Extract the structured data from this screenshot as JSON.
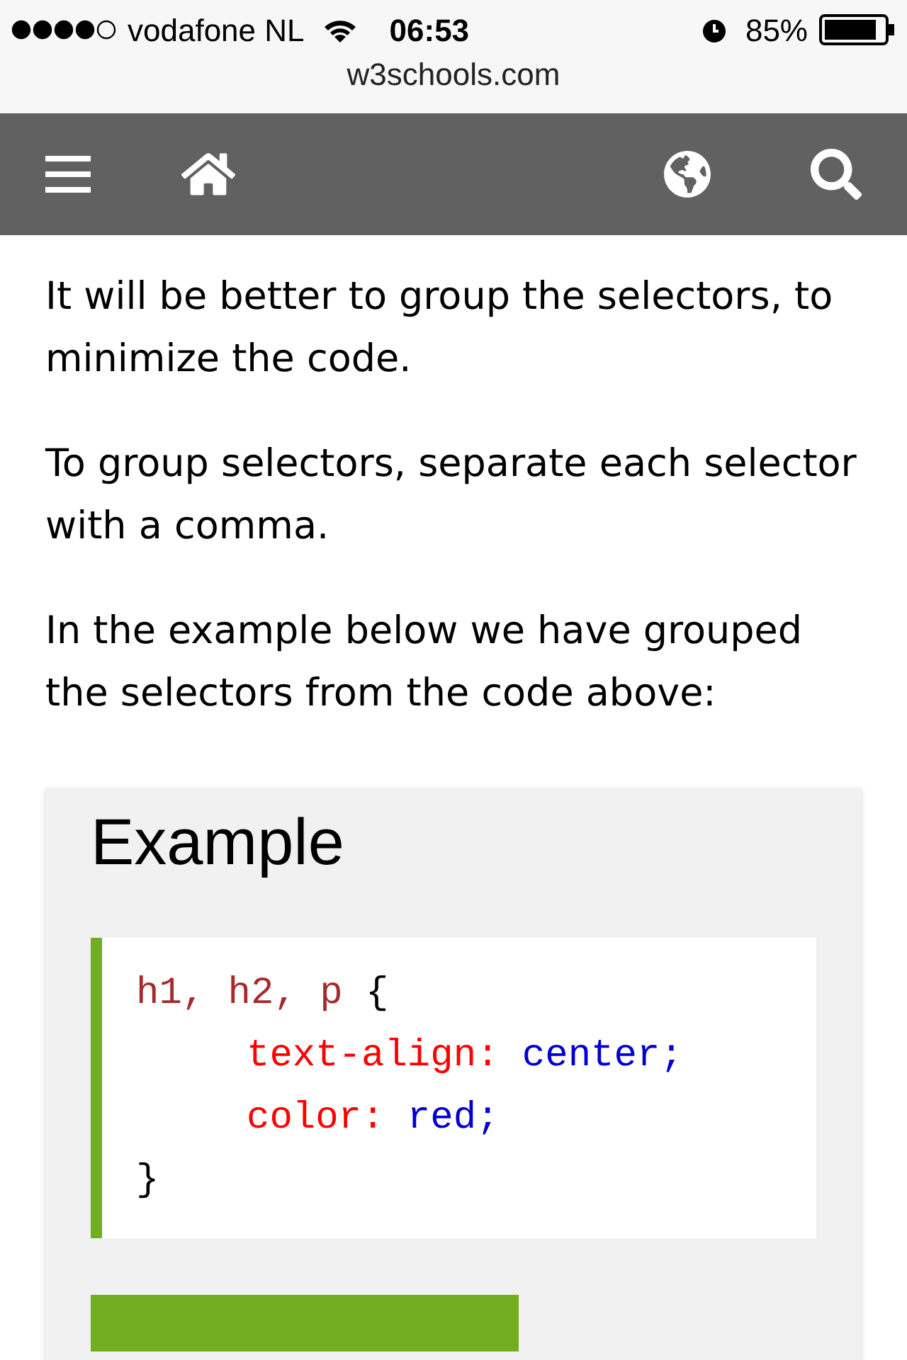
{
  "status_bar": {
    "carrier": "vodafone NL",
    "time": "06:53",
    "battery": "85%"
  },
  "address_bar": {
    "url": "w3schools.com"
  },
  "paragraphs": [
    "It will be better to group the selectors, to minimize the code.",
    "To group selectors, separate each selector with a comma.",
    "In the example below we have grouped the selectors from the code above:"
  ],
  "example": {
    "title": "Example",
    "code_lines": [
      {
        "indent": false,
        "tokens": [
          {
            "kind": "selector",
            "text": "h1, h2, p"
          },
          {
            "kind": "bracket",
            "text": "{"
          }
        ]
      },
      {
        "indent": true,
        "tokens": [
          {
            "kind": "property",
            "text": "text-align:"
          },
          {
            "kind": "value",
            "text": "center;"
          }
        ]
      },
      {
        "indent": true,
        "tokens": [
          {
            "kind": "property",
            "text": "color:"
          },
          {
            "kind": "value",
            "text": "red;"
          }
        ]
      },
      {
        "indent": false,
        "tokens": [
          {
            "kind": "bracket",
            "text": "}"
          }
        ]
      }
    ]
  }
}
